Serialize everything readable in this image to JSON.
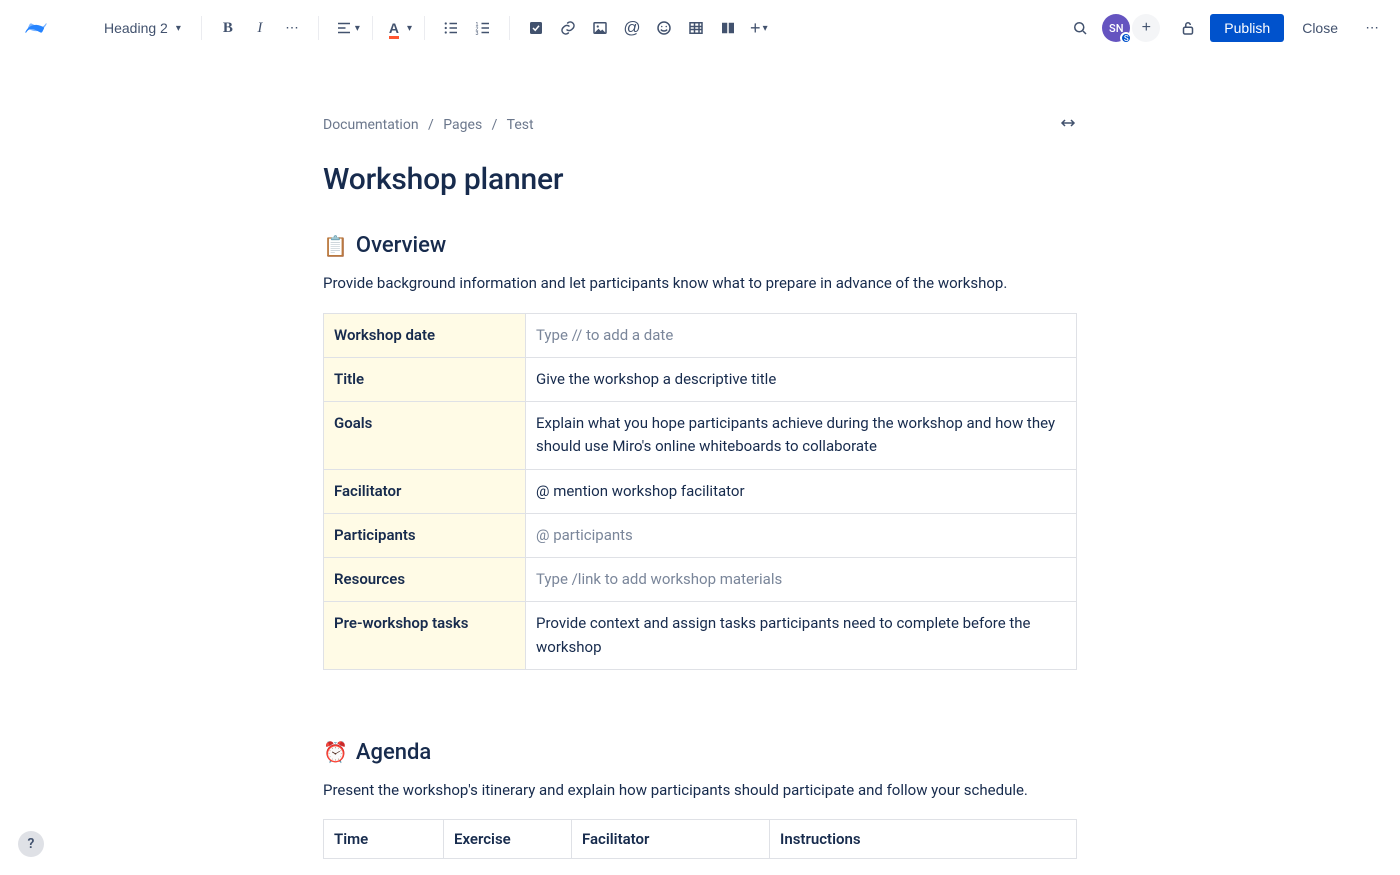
{
  "toolbar": {
    "style_label": "Heading 2",
    "publish_label": "Publish",
    "close_label": "Close"
  },
  "avatar": {
    "initials": "SN",
    "sub": "S"
  },
  "breadcrumbs": [
    "Documentation",
    "Pages",
    "Test"
  ],
  "page_title": "Workshop planner",
  "overview": {
    "emoji": "📋",
    "heading": "Overview",
    "desc": "Provide background information and let participants know what to prepare in advance of the workshop.",
    "rows": [
      {
        "label": "Workshop date",
        "value": "Type // to add a date",
        "placeholder": true
      },
      {
        "label": "Title",
        "value": "Give the workshop a descriptive title",
        "placeholder": false
      },
      {
        "label": "Goals",
        "value": "Explain what you hope participants achieve during the workshop and how they should use Miro's online whiteboards to collaborate",
        "placeholder": false
      },
      {
        "label": "Facilitator",
        "value": "@ mention workshop facilitator",
        "placeholder": false
      },
      {
        "label": "Participants",
        "value": "@ participants",
        "placeholder": true
      },
      {
        "label": "Resources",
        "value": "Type /link to add workshop materials",
        "placeholder": true
      },
      {
        "label": "Pre-workshop tasks",
        "value": "Provide context and assign tasks participants need to complete before the workshop",
        "placeholder": false
      }
    ]
  },
  "agenda": {
    "emoji": "⏰",
    "heading": "Agenda",
    "desc": "Present the workshop's itinerary and explain how participants should participate and follow your schedule.",
    "columns": [
      "Time",
      "Exercise",
      "Facilitator",
      "Instructions"
    ]
  }
}
